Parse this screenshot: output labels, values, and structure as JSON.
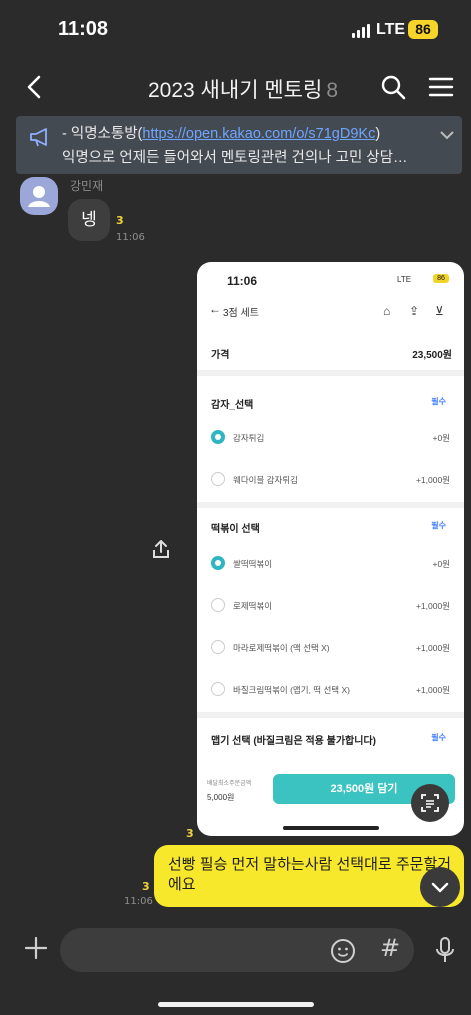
{
  "status_bar": {
    "time": "11:08",
    "network": "LTE",
    "battery": "86"
  },
  "header": {
    "title": "2023 새내기 멘토링",
    "member_count": "8"
  },
  "notice": {
    "prefix": "- 익명소통방(",
    "link": "https://open.kakao.com/o/s71gD9Kc",
    "suffix": ")",
    "line2": "익명으로 언제든 들어와서 멘토링관련 건의나 고민 상담…"
  },
  "messages": [
    {
      "sender": "강민재",
      "text": "넹",
      "unread": "3",
      "time": "11:06"
    },
    {
      "type": "image",
      "unread": "3"
    },
    {
      "text": "선빵 필승 먼저 말하는사람 선택대로 주문할거에요",
      "unread": "3",
      "time": "11:06"
    }
  ],
  "shared_screenshot": {
    "time": "11:06",
    "status": "LTE",
    "battery": "86",
    "nav_title": "3점 세트",
    "price_label": "가격",
    "price": "23,500원",
    "sections": [
      {
        "title": "감자_선택",
        "tag": "필수",
        "options": [
          {
            "label": "감자튀김",
            "price": "+0원",
            "selected": true
          },
          {
            "label": "웨다이블 감자튀김",
            "price": "+1,000원",
            "selected": false
          }
        ]
      },
      {
        "title": "떡볶이 선택",
        "tag": "필수",
        "options": [
          {
            "label": "쌀떡떡볶이",
            "price": "+0원",
            "selected": true
          },
          {
            "label": "로제떡볶이",
            "price": "+1,000원",
            "selected": false
          },
          {
            "label": "마라로제떡볶이 (맥 선택 X)",
            "price": "+1,000원",
            "selected": false
          },
          {
            "label": "바질크림떡볶이 (맵기, 떡 선택 X)",
            "price": "+1,000원",
            "selected": false
          }
        ]
      },
      {
        "title": "맵기 선택 (바질크림은 적용 불가합니다)",
        "tag": "필수",
        "options": []
      }
    ],
    "cta_sub": "배달최소주문금액",
    "cta_min": "5,000원",
    "cta": "23,500원 담기"
  },
  "colors": {
    "background": "#2b2b2b",
    "my_bubble": "#f8e82c",
    "link": "#6ea6ff",
    "unread": "#f2d23a",
    "cta": "#3ac3c0"
  }
}
